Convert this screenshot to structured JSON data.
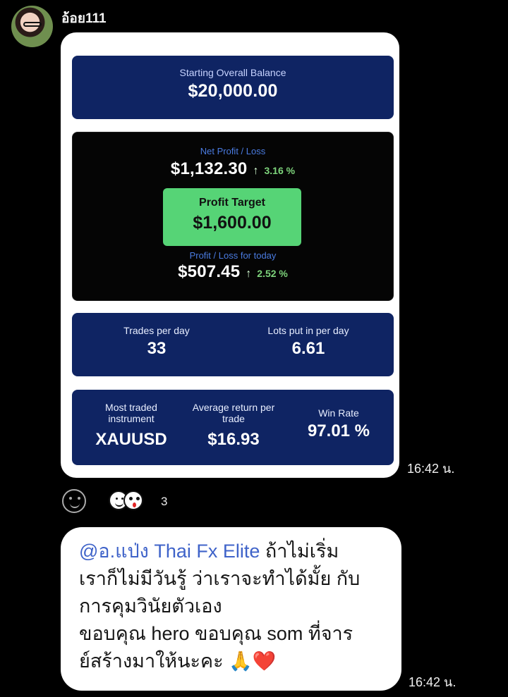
{
  "chat": {
    "username": "อ้อย111",
    "time_1": "16:42 น.",
    "time_2": "16:42 น.",
    "reaction_count": "3"
  },
  "image": {
    "starting_label": "Starting Overall Balance",
    "starting_value": "$20,000.00",
    "net_label": "Net Profit / Loss",
    "net_value": "$1,132.30",
    "net_pct": "3.16 %",
    "target_label": "Profit Target",
    "target_value": "$1,600.00",
    "today_label": "Profit / Loss for today",
    "today_value": "$507.45",
    "today_pct": "2.52 %",
    "trades_label": "Trades per day",
    "trades_value": "33",
    "lots_label": "Lots put in per day",
    "lots_value": "6.61",
    "instrument_label": "Most traded instrument",
    "instrument_value": "XAUUSD",
    "avg_label": "Average return per trade",
    "avg_value": "$16.93",
    "win_label": "Win Rate",
    "win_value": "97.01 %"
  },
  "message": {
    "mention": "@อ.แป่ง Thai Fx Elite",
    "line1_rest": " ถ้าไม่เริ่ม",
    "line2": "เราก็ไม่มีวันรู้ ว่าเราจะทำได้มั้ย กับ",
    "line3": "การคุมวินัยตัวเอง",
    "line4": "ขอบคุณ hero ขอบคุณ som ที่จาร",
    "line5": "ย์สร้างมาให้นะคะ",
    "emoji": "🙏❤️"
  },
  "colors": {
    "navy": "#0f2463",
    "green": "#56d476",
    "mention": "#3f63c9"
  }
}
